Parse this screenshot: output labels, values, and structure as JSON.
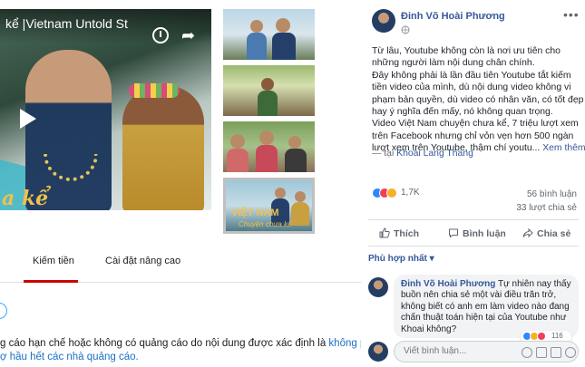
{
  "youtube": {
    "video_title": "kể |Vietnam Untold St",
    "tabs": {
      "monetization": "Kiếm tiền",
      "advanced": "Cài đặt nâng cao"
    },
    "notice": {
      "line1_text": "g cáo hạn chế hoặc không có quảng cáo do nội dung được xác định là ",
      "line1_link": "không phù",
      "line2_link": "ợ hầu hết các nhà quảng cáo."
    },
    "thumbnail_overlay": {
      "title": "VIỆT NAM",
      "subtitle": "Chuyện chưa kể"
    },
    "player_script": "a kể"
  },
  "facebook": {
    "author": "Đinh Võ Hoài Phương",
    "body": [
      "Từ lâu, Youtube không còn là nơi ưu tiên cho",
      "những người làm nội dung chân chính.",
      "Đây không phải là lần đầu tiên Youtube tắt kiếm",
      "tiền video của mình, dù nội dung video không vi",
      "phạm bản quyền, dù video có nhân văn, có tốt đẹp",
      "hay ý nghĩa đến mấy, nó không quan trọng.",
      "Video Việt Nam chuyện chưa kể, 7 triệu lượt xem",
      "trên Facebook nhưng chỉ vỏn vẹn hơn 500 ngàn",
      "lượt xem trên Youtube, thậm chí youtu... "
    ],
    "see_more": "Xem thêm",
    "place_prefix": "— tại ",
    "place": "Khoai Lang Thang",
    "reactions_count": "1,7K",
    "comments_count": "56 bình luận",
    "shares_count": "33 lượt chia sẻ",
    "actions": {
      "like": "Thích",
      "comment": "Bình luận",
      "share": "Chia sẻ"
    },
    "filter": "Phù hợp nhất ▾",
    "comment": {
      "author": "Đinh Võ Hoài Phương",
      "text_first": " Tự nhiên nay thấy",
      "lines": [
        "buồn nên chia sẻ một vài điều trăn trở,",
        "không biết có anh em làm video nào đang",
        "chấn thuật toán hiện tại của Youtube như",
        "Khoai không?"
      ],
      "reaction_count": "116"
    },
    "write_placeholder": "Viết bình luận...",
    "colors": {
      "link": "#365899",
      "like": "#2d88ff",
      "love": "#f33e58",
      "haha": "#f7b125"
    }
  }
}
